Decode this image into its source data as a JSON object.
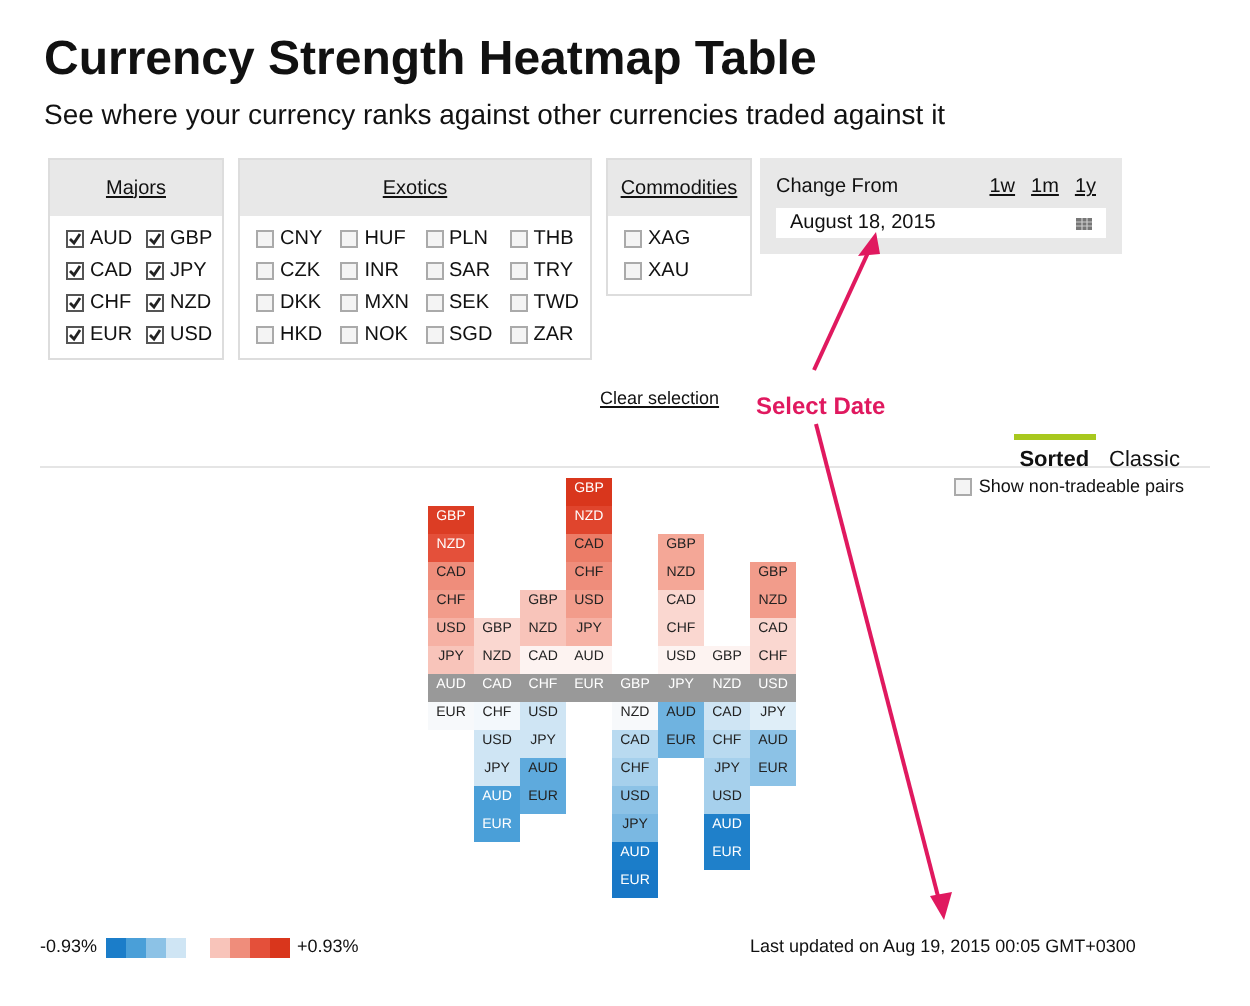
{
  "title": "Currency Strength Heatmap Table",
  "subtitle": "See where your currency ranks against other currencies traded against it",
  "groups": [
    {
      "title": "Majors",
      "items": [
        {
          "label": "AUD",
          "checked": true
        },
        {
          "label": "GBP",
          "checked": true
        },
        {
          "label": "CAD",
          "checked": true
        },
        {
          "label": "JPY",
          "checked": true
        },
        {
          "label": "CHF",
          "checked": true
        },
        {
          "label": "NZD",
          "checked": true
        },
        {
          "label": "EUR",
          "checked": true
        },
        {
          "label": "USD",
          "checked": true
        }
      ]
    },
    {
      "title": "Exotics",
      "items": [
        {
          "label": "CNY",
          "checked": false
        },
        {
          "label": "HUF",
          "checked": false
        },
        {
          "label": "PLN",
          "checked": false
        },
        {
          "label": "THB",
          "checked": false
        },
        {
          "label": "CZK",
          "checked": false
        },
        {
          "label": "INR",
          "checked": false
        },
        {
          "label": "SAR",
          "checked": false
        },
        {
          "label": "TRY",
          "checked": false
        },
        {
          "label": "DKK",
          "checked": false
        },
        {
          "label": "MXN",
          "checked": false
        },
        {
          "label": "SEK",
          "checked": false
        },
        {
          "label": "TWD",
          "checked": false
        },
        {
          "label": "HKD",
          "checked": false
        },
        {
          "label": "NOK",
          "checked": false
        },
        {
          "label": "SGD",
          "checked": false
        },
        {
          "label": "ZAR",
          "checked": false
        }
      ]
    },
    {
      "title": "Commodities",
      "items": [
        {
          "label": "XAG",
          "checked": false
        },
        {
          "label": "XAU",
          "checked": false
        }
      ]
    }
  ],
  "change_from": {
    "label": "Change From",
    "presets": [
      "1w",
      "1m",
      "1y"
    ],
    "date": "August 18, 2015"
  },
  "clear_selection": "Clear selection",
  "annotation": "Select Date",
  "view_tabs": [
    {
      "label": "Sorted",
      "selected": true
    },
    {
      "label": "Classic",
      "selected": false
    }
  ],
  "show_non_tradeable": {
    "label": "Show non-tradeable pairs",
    "checked": false
  },
  "heatmap": {
    "columns": [
      {
        "currency": "AUD",
        "above": [
          {
            "label": "GBP",
            "color": "#dc3d24"
          },
          {
            "label": "NZD",
            "color": "#e4503a"
          },
          {
            "label": "CAD",
            "color": "#ef8d7b"
          },
          {
            "label": "CHF",
            "color": "#f29c8b"
          },
          {
            "label": "USD",
            "color": "#f6b1a4"
          },
          {
            "label": "JPY",
            "color": "#f8c4ba"
          }
        ],
        "below": [
          {
            "label": "EUR",
            "color": "#f7f9fb"
          }
        ]
      },
      {
        "currency": "CAD",
        "above": [
          {
            "label": "GBP",
            "color": "#fad7d0"
          },
          {
            "label": "NZD",
            "color": "#fad7d0"
          }
        ],
        "below": [
          {
            "label": "CHF",
            "color": "#f3f8fc"
          },
          {
            "label": "USD",
            "color": "#cfe5f4"
          },
          {
            "label": "JPY",
            "color": "#cfe5f4"
          },
          {
            "label": "AUD",
            "color": "#4a9fd8"
          },
          {
            "label": "EUR",
            "color": "#4a9fd8"
          }
        ]
      },
      {
        "currency": "CHF",
        "above": [
          {
            "label": "GBP",
            "color": "#f8c4ba"
          },
          {
            "label": "NZD",
            "color": "#f8c4ba"
          },
          {
            "label": "CAD",
            "color": "#fdf3f1"
          }
        ],
        "below": [
          {
            "label": "USD",
            "color": "#cfe5f4"
          },
          {
            "label": "JPY",
            "color": "#cfe5f4"
          },
          {
            "label": "AUD",
            "color": "#5eaadd"
          },
          {
            "label": "EUR",
            "color": "#5eaadd"
          }
        ]
      },
      {
        "currency": "EUR",
        "above": [
          {
            "label": "GBP",
            "color": "#d9361c"
          },
          {
            "label": "NZD",
            "color": "#e0452d"
          },
          {
            "label": "CAD",
            "color": "#ec7c67"
          },
          {
            "label": "CHF",
            "color": "#ef8d7b"
          },
          {
            "label": "USD",
            "color": "#f29c8b"
          },
          {
            "label": "JPY",
            "color": "#f6b1a4"
          },
          {
            "label": "AUD",
            "color": "#fdf3f1"
          }
        ]
      },
      {
        "currency": "GBP",
        "below": [
          {
            "label": "NZD",
            "color": "#f7f9fb"
          },
          {
            "label": "CAD",
            "color": "#b9daf0"
          },
          {
            "label": "CHF",
            "color": "#a6d0ec"
          },
          {
            "label": "USD",
            "color": "#8cc2e6"
          },
          {
            "label": "JPY",
            "color": "#7ab8e2"
          },
          {
            "label": "AUD",
            "color": "#1b7dc9"
          },
          {
            "label": "EUR",
            "color": "#1877c6"
          }
        ]
      },
      {
        "currency": "JPY",
        "above": [
          {
            "label": "GBP",
            "color": "#f4a797"
          },
          {
            "label": "NZD",
            "color": "#f4a797"
          },
          {
            "label": "CAD",
            "color": "#fad7d0"
          },
          {
            "label": "CHF",
            "color": "#fad7d0"
          },
          {
            "label": "USD",
            "color": "#fdf3f1"
          }
        ],
        "below": [
          {
            "label": "AUD",
            "color": "#6fb3e0"
          },
          {
            "label": "EUR",
            "color": "#6fb3e0"
          }
        ]
      },
      {
        "currency": "NZD",
        "above": [
          {
            "label": "GBP",
            "color": "#fdf3f1"
          }
        ],
        "below": [
          {
            "label": "CAD",
            "color": "#cfe5f4"
          },
          {
            "label": "CHF",
            "color": "#b9daf0"
          },
          {
            "label": "JPY",
            "color": "#a6d0ec"
          },
          {
            "label": "USD",
            "color": "#a6d0ec"
          },
          {
            "label": "AUD",
            "color": "#1f80ca"
          },
          {
            "label": "EUR",
            "color": "#1f80ca"
          }
        ]
      },
      {
        "currency": "USD",
        "above": [
          {
            "label": "GBP",
            "color": "#f29c8b"
          },
          {
            "label": "NZD",
            "color": "#f29c8b"
          },
          {
            "label": "CAD",
            "color": "#fad7d0"
          },
          {
            "label": "CHF",
            "color": "#fad7d0"
          }
        ],
        "below": [
          {
            "label": "JPY",
            "color": "#dfeef8"
          },
          {
            "label": "AUD",
            "color": "#8cc2e6"
          },
          {
            "label": "EUR",
            "color": "#8cc2e6"
          }
        ]
      }
    ]
  },
  "legend": {
    "min": "-0.93%",
    "max": "+0.93%",
    "negative_swatches": [
      {
        "color": "#1b7dc9"
      },
      {
        "color": "#4a9fd8"
      },
      {
        "color": "#8cc2e6"
      },
      {
        "color": "#cfe5f4"
      }
    ],
    "positive_swatches": [
      {
        "color": "#f8c4ba"
      },
      {
        "color": "#ef8d7b"
      },
      {
        "color": "#e4503a"
      },
      {
        "color": "#d9361c"
      }
    ]
  },
  "last_updated": "Last updated on Aug 19, 2015 00:05 GMT+0300"
}
